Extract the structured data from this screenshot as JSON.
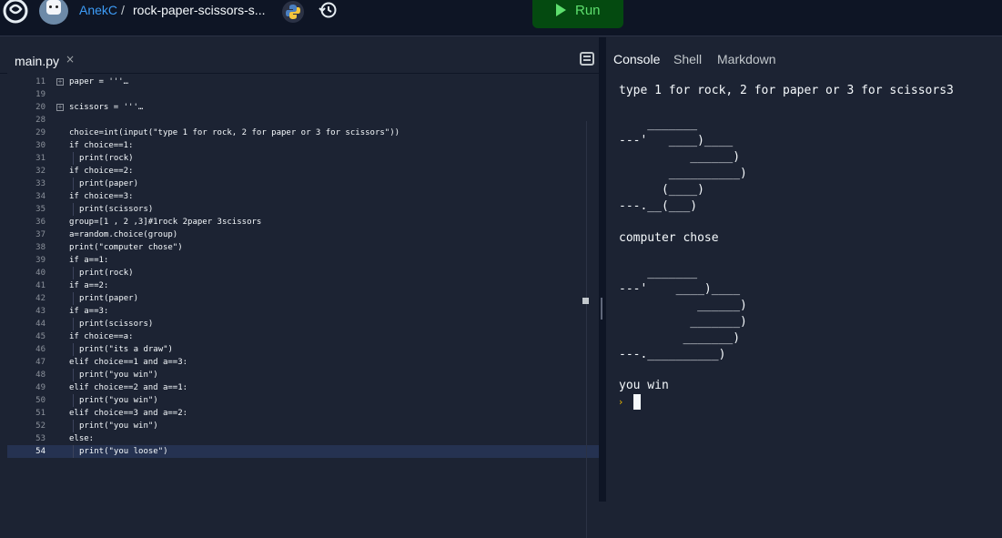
{
  "header": {
    "username": "AnekC",
    "separator": "/",
    "repl_name": "rock-paper-scissors-s...",
    "run_label": "Run",
    "icons": [
      "replit-logo-icon",
      "avatar",
      "python-icon",
      "history-icon",
      "play-icon"
    ],
    "run_color": "#5edf6e"
  },
  "editor": {
    "tab_label": "main.py",
    "tab_close": "×",
    "lines": [
      {
        "n": "11",
        "text": "paper = '''…",
        "fold": true
      },
      {
        "n": "19",
        "text": ""
      },
      {
        "n": "20",
        "text": "scissors = '''…",
        "fold": true
      },
      {
        "n": "28",
        "text": ""
      },
      {
        "n": "29",
        "text": "choice=int(input(\"type 1 for rock, 2 for paper or 3 for scissors\"))"
      },
      {
        "n": "30",
        "text": "if choice==1:"
      },
      {
        "n": "31",
        "text": "print(rock)",
        "indent": true
      },
      {
        "n": "32",
        "text": "if choice==2:"
      },
      {
        "n": "33",
        "text": "print(paper)",
        "indent": true
      },
      {
        "n": "34",
        "text": "if choice==3:"
      },
      {
        "n": "35",
        "text": "print(scissors)",
        "indent": true
      },
      {
        "n": "36",
        "text": "group=[1 , 2 ,3]#1rock 2paper 3scissors"
      },
      {
        "n": "37",
        "text": "a=random.choice(group)"
      },
      {
        "n": "38",
        "text": "print(\"computer chose\")"
      },
      {
        "n": "39",
        "text": "if a==1:"
      },
      {
        "n": "40",
        "text": "print(rock)",
        "indent": true
      },
      {
        "n": "41",
        "text": "if a==2:"
      },
      {
        "n": "42",
        "text": "print(paper)",
        "indent": true
      },
      {
        "n": "43",
        "text": "if a==3:"
      },
      {
        "n": "44",
        "text": "print(scissors)",
        "indent": true
      },
      {
        "n": "45",
        "text": "if choice==a:"
      },
      {
        "n": "46",
        "text": "print(\"its a draw\")",
        "indent": true
      },
      {
        "n": "47",
        "text": "elif choice==1 and a==3:"
      },
      {
        "n": "48",
        "text": "print(\"you win\")",
        "indent": true
      },
      {
        "n": "49",
        "text": "elif choice==2 and a==1:"
      },
      {
        "n": "50",
        "text": "print(\"you win\")",
        "indent": true
      },
      {
        "n": "51",
        "text": "elif choice==3 and a==2:"
      },
      {
        "n": "52",
        "text": "print(\"you win\")",
        "indent": true
      },
      {
        "n": "53",
        "text": "else:"
      },
      {
        "n": "54",
        "text": "print(\"you loose\")",
        "indent": true,
        "active": true
      }
    ]
  },
  "console": {
    "tabs": [
      "Console",
      "Shell",
      "Markdown"
    ],
    "active_tab": "Console",
    "prompt_line": "type 1 for rock, 2 for paper or 3 for scissors3",
    "art_user": "    _______\n---'   ____)____\n          ______)\n       __________)\n      (____)\n---.__(___)",
    "computer_line": "computer chose",
    "art_computer": "    _______\n---'    ____)____\n           ______)\n          _______)\n         _______)\n---.__________)",
    "result_line": "you win",
    "prompt_symbol": "›"
  }
}
